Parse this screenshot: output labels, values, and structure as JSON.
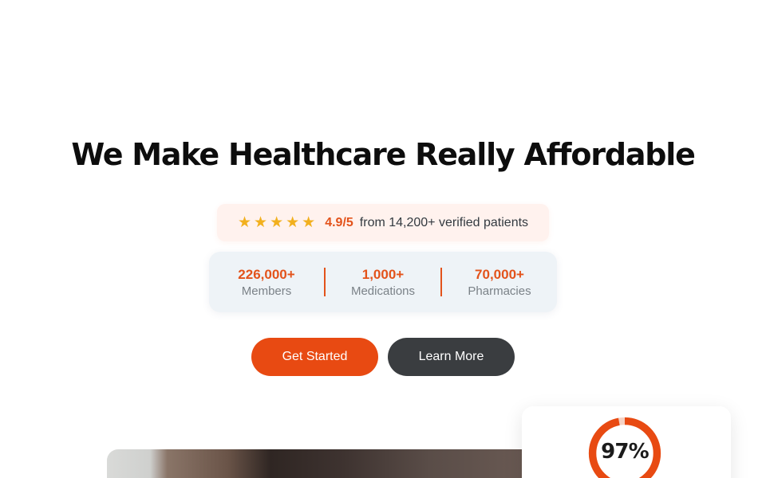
{
  "hero": {
    "headline": "We Make Healthcare Really Affordable"
  },
  "rating": {
    "stars": 5,
    "score": "4.9/5",
    "text": "from 14,200+ verified patients"
  },
  "stats": [
    {
      "value": "226,000+",
      "label": "Members"
    },
    {
      "value": "1,000+",
      "label": "Medications"
    },
    {
      "value": "70,000+",
      "label": "Pharmacies"
    }
  ],
  "buttons": {
    "primary_label": "Get Started",
    "secondary_label": "Learn More"
  },
  "float_card": {
    "percent_label": "97%",
    "percent_value": 0.97
  },
  "colors": {
    "accent": "#e84a12",
    "accent_text": "#e3531b",
    "star": "#f2b01e",
    "dark_button": "#3a3d40"
  }
}
